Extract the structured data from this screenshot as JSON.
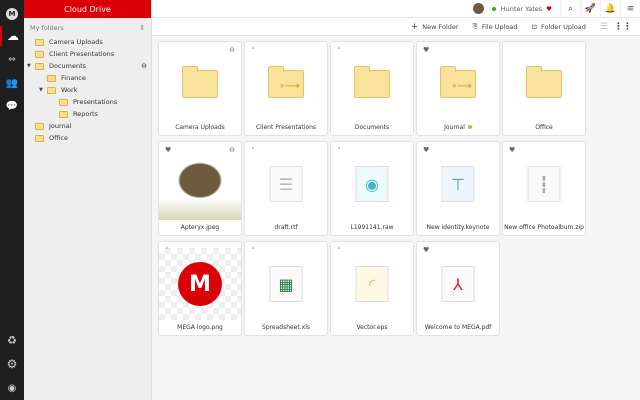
{
  "nav": {
    "items": [
      "mega-logo",
      "cloud-drive",
      "transfers",
      "contacts",
      "chat"
    ],
    "bottom": [
      "rubbish-bin",
      "settings",
      "account"
    ]
  },
  "tree": {
    "header": "Cloud Drive",
    "title": "My folders",
    "nodes": [
      {
        "label": "Camera Uploads",
        "level": 0
      },
      {
        "label": "Client Presentations",
        "level": 0,
        "shared": true
      },
      {
        "label": "Documents",
        "level": 0,
        "expanded": true,
        "link": true
      },
      {
        "label": "Finance",
        "level": 1
      },
      {
        "label": "Work",
        "level": 1,
        "expanded": true
      },
      {
        "label": "Presentations",
        "level": 2
      },
      {
        "label": "Reports",
        "level": 2
      },
      {
        "label": "Journal",
        "level": 0,
        "shared": true
      },
      {
        "label": "Office",
        "level": 0
      }
    ]
  },
  "topbar": {
    "user": "Hunter Yates",
    "status_color": "#31b500"
  },
  "toolbar": {
    "new_folder": "New Folder",
    "file_upload": "File Upload",
    "folder_upload": "Folder Upload"
  },
  "files": [
    {
      "name": "Camera Uploads",
      "type": "folder",
      "mark": "eye"
    },
    {
      "name": "Client Presentations",
      "type": "shared-folder",
      "mark": "dot"
    },
    {
      "name": "Documents",
      "type": "folder",
      "mark": "dot"
    },
    {
      "name": "Journal",
      "type": "shared-folder",
      "mark": "fav",
      "label_dot": "#f0a030"
    },
    {
      "name": "Office",
      "type": "folder"
    },
    {
      "name": "Apteryx.jpeg",
      "type": "image",
      "mark": "fav",
      "eye": true
    },
    {
      "name": "draft.rtf",
      "type": "text",
      "mark": "dot"
    },
    {
      "name": "L1991141.raw",
      "type": "raw",
      "mark": "dot"
    },
    {
      "name": "New identity.keynote",
      "type": "keynote",
      "mark": "fav"
    },
    {
      "name": "New office Photoalbum.zip",
      "type": "zip",
      "mark": "fav"
    },
    {
      "name": "MEGA logo.png",
      "type": "png",
      "mark": "dot"
    },
    {
      "name": "Spreadsheet.xls",
      "type": "xls",
      "mark": "dot"
    },
    {
      "name": "Vector.eps",
      "type": "eps",
      "mark": "dot"
    },
    {
      "name": "Welcome to MEGA.pdf",
      "type": "pdf",
      "mark": "fav"
    }
  ]
}
